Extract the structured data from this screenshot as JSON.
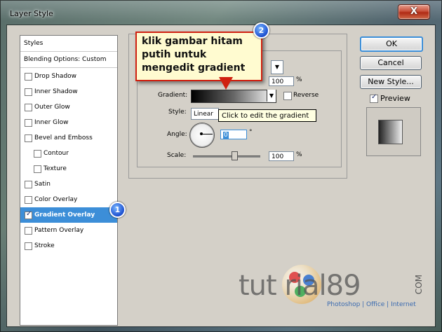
{
  "window": {
    "title": "Layer Style",
    "close_label": "X"
  },
  "sidebar": {
    "header": "Styles",
    "blending": "Blending Options: Custom",
    "items": [
      {
        "label": "Drop Shadow",
        "checked": false,
        "indent": false
      },
      {
        "label": "Inner Shadow",
        "checked": false,
        "indent": false
      },
      {
        "label": "Outer Glow",
        "checked": false,
        "indent": false
      },
      {
        "label": "Inner Glow",
        "checked": false,
        "indent": false
      },
      {
        "label": "Bevel and Emboss",
        "checked": false,
        "indent": false
      },
      {
        "label": "Contour",
        "checked": false,
        "indent": true
      },
      {
        "label": "Texture",
        "checked": false,
        "indent": true
      },
      {
        "label": "Satin",
        "checked": false,
        "indent": false
      },
      {
        "label": "Color Overlay",
        "checked": false,
        "indent": false
      },
      {
        "label": "Gradient Overlay",
        "checked": true,
        "indent": false,
        "selected": true
      },
      {
        "label": "Pattern Overlay",
        "checked": false,
        "indent": false
      },
      {
        "label": "Stroke",
        "checked": false,
        "indent": false
      }
    ]
  },
  "panel": {
    "opacity_value": "100",
    "opacity_unit": "%",
    "gradient_label": "Gradient:",
    "reverse_label": "Reverse",
    "style_label": "Style:",
    "style_value": "Linear",
    "angle_label": "Angle:",
    "angle_value": "0",
    "angle_unit": "°",
    "scale_label": "Scale:",
    "scale_value": "100",
    "scale_unit": "%",
    "scale_level": 0.6,
    "tooltip": "Click to edit the gradient"
  },
  "callout": {
    "text": "klik gambar hitam putih untuk mengedit gradient",
    "badge": "2"
  },
  "badge1": "1",
  "buttons": {
    "ok": "OK",
    "cancel": "Cancel",
    "new_style": "New Style...",
    "preview_label": "Preview",
    "preview_checked": true
  },
  "watermark": {
    "text": "tut  rial89",
    "sub": "Photoshop | Office | Internet",
    "com": "COM"
  }
}
